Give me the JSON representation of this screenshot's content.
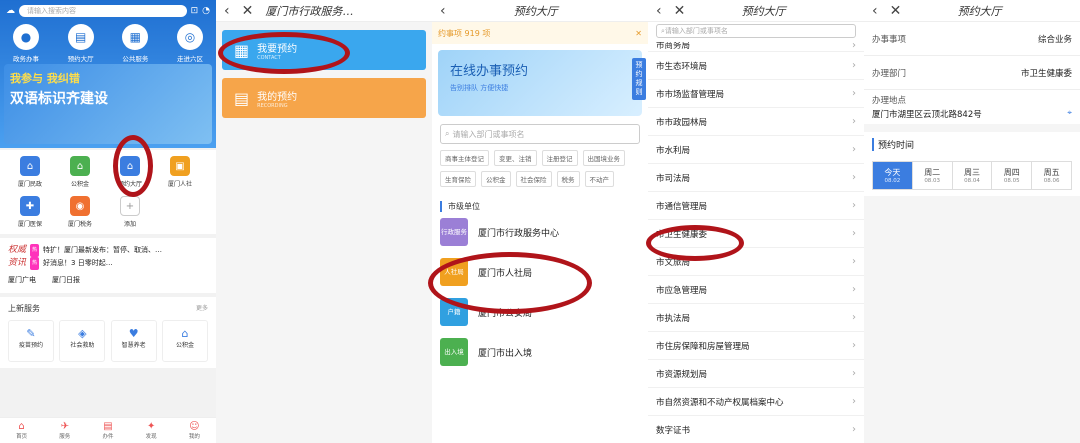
{
  "p1": {
    "search_placeholder": "请输入搜索内容",
    "quick": [
      {
        "label": "政务办事",
        "icon": "person-icon"
      },
      {
        "label": "预约大厅",
        "icon": "clipboard-icon"
      },
      {
        "label": "公共服务",
        "icon": "building-icon"
      },
      {
        "label": "走进六区",
        "icon": "globe-icon"
      }
    ],
    "banner_line1": "我参与 我纠错",
    "banner_line2": "双语标识齐建设",
    "grid": [
      {
        "label": "厦门民政",
        "color": "#3b7de0"
      },
      {
        "label": "公积金",
        "color": "#4cb050"
      },
      {
        "label": "预约大厅",
        "color": "#3b7de0"
      },
      {
        "label": "厦门人社",
        "color": "#f0a020"
      },
      {
        "label": "厦门医保",
        "color": "#3b7de0"
      },
      {
        "label": "厦门税务",
        "color": "#f07030"
      },
      {
        "label": "添加",
        "color": "#ccc"
      }
    ],
    "news_tag1": "权威",
    "news_tag2": "资讯",
    "news1": "特扩！厦门最新发布：暂停、取消、…",
    "news2": "好消息！3 日零时起…",
    "news_sources": [
      "厦门广电",
      "厦门日报"
    ],
    "services_title": "上新服务",
    "services_more": "更多",
    "services": [
      {
        "label": "疫苗预约"
      },
      {
        "label": "社会救助"
      },
      {
        "label": "智慧养老"
      },
      {
        "label": "公积金"
      }
    ],
    "tabs": [
      "首页",
      "服务",
      "办件",
      "发现",
      "我的"
    ]
  },
  "p2": {
    "title": "厦门市行政服务…",
    "btn1": "我要预约",
    "btn1_sub": "CONTACT",
    "btn2": "我的预约",
    "btn2_sub": "RECORDING"
  },
  "p3": {
    "title": "预约大厅",
    "notice": "约事项 919 项",
    "banner_title": "在线办事预约",
    "banner_sub": "告别排队 方便快捷",
    "side_label": "预约规则",
    "search_placeholder": "请输入部门或事项名",
    "tags": [
      "商事主体登记",
      "变更、注销",
      "注册登记",
      "出国境业务",
      "生育保险",
      "公积金",
      "社会保险",
      "税务",
      "不动产"
    ],
    "section": "市级单位",
    "orgs": [
      {
        "name": "厦门市行政服务中心",
        "badge": "行政服务",
        "color": "#9b7fd6"
      },
      {
        "name": "厦门市人社局",
        "badge": "人社局",
        "color": "#f0a020"
      },
      {
        "name": "厦门市公安局",
        "badge": "户籍",
        "color": "#30a0e0"
      },
      {
        "name": "厦门市出入境",
        "badge": "出入境",
        "color": "#4cb050"
      }
    ]
  },
  "p4": {
    "title": "预约大厅",
    "search_placeholder": "请输入部门或事项名",
    "items": [
      "市商务局",
      "市生态环境局",
      "市市场监督管理局",
      "市市政园林局",
      "市水利局",
      "市司法局",
      "市通信管理局",
      "市卫生健康委",
      "市文旅局",
      "市应急管理局",
      "市执法局",
      "市住房保障和房屋管理局",
      "市资源规划局",
      "市自然资源和不动产权属档案中心",
      "数字证书"
    ]
  },
  "p5": {
    "title": "预约大厅",
    "rows": [
      {
        "k": "办事事项",
        "v": "综合业务"
      },
      {
        "k": "办理部门",
        "v": "市卫生健康委"
      }
    ],
    "addr_k": "办理地点",
    "addr_v": "厦门市湖里区云顶北路842号",
    "time_title": "预约时间",
    "days": [
      {
        "w": "今天",
        "d": "08.02"
      },
      {
        "w": "周二",
        "d": "08.03"
      },
      {
        "w": "周三",
        "d": "08.04"
      },
      {
        "w": "周四",
        "d": "08.05"
      },
      {
        "w": "周五",
        "d": "08.06"
      }
    ]
  }
}
